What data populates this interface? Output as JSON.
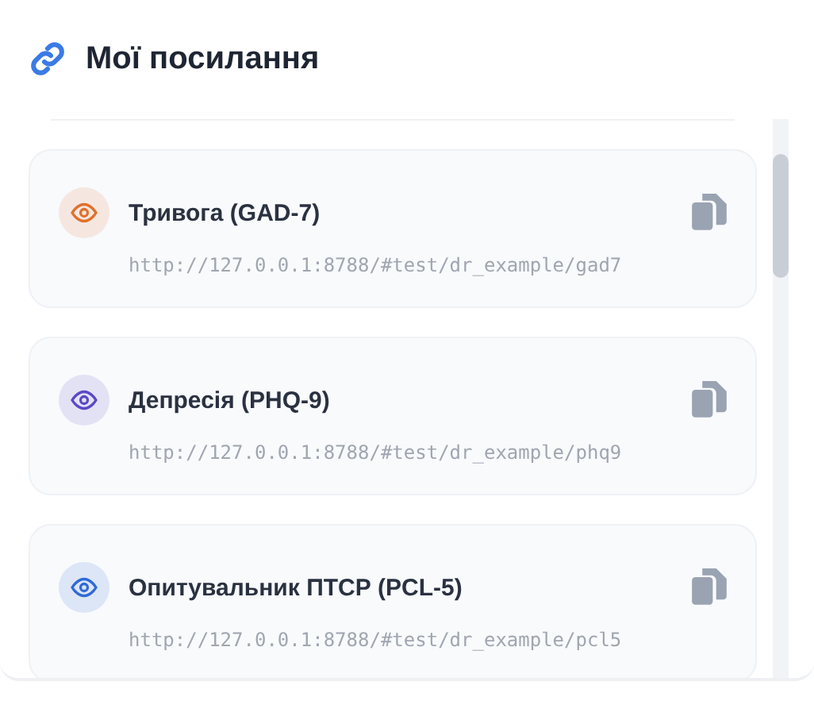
{
  "header": {
    "title": "Мої посилання"
  },
  "links": [
    {
      "title": "Тривога (GAD-7)",
      "url": "http://127.0.0.1:8788/#test/dr_example/gad7",
      "color": "#e0702a"
    },
    {
      "title": "Депресія (PHQ-9)",
      "url": "http://127.0.0.1:8788/#test/dr_example/phq9",
      "color": "#5a48c8"
    },
    {
      "title": "Опитувальник ПТСР (PCL-5)",
      "url": "http://127.0.0.1:8788/#test/dr_example/pcl5",
      "color": "#2f6ad8"
    }
  ]
}
